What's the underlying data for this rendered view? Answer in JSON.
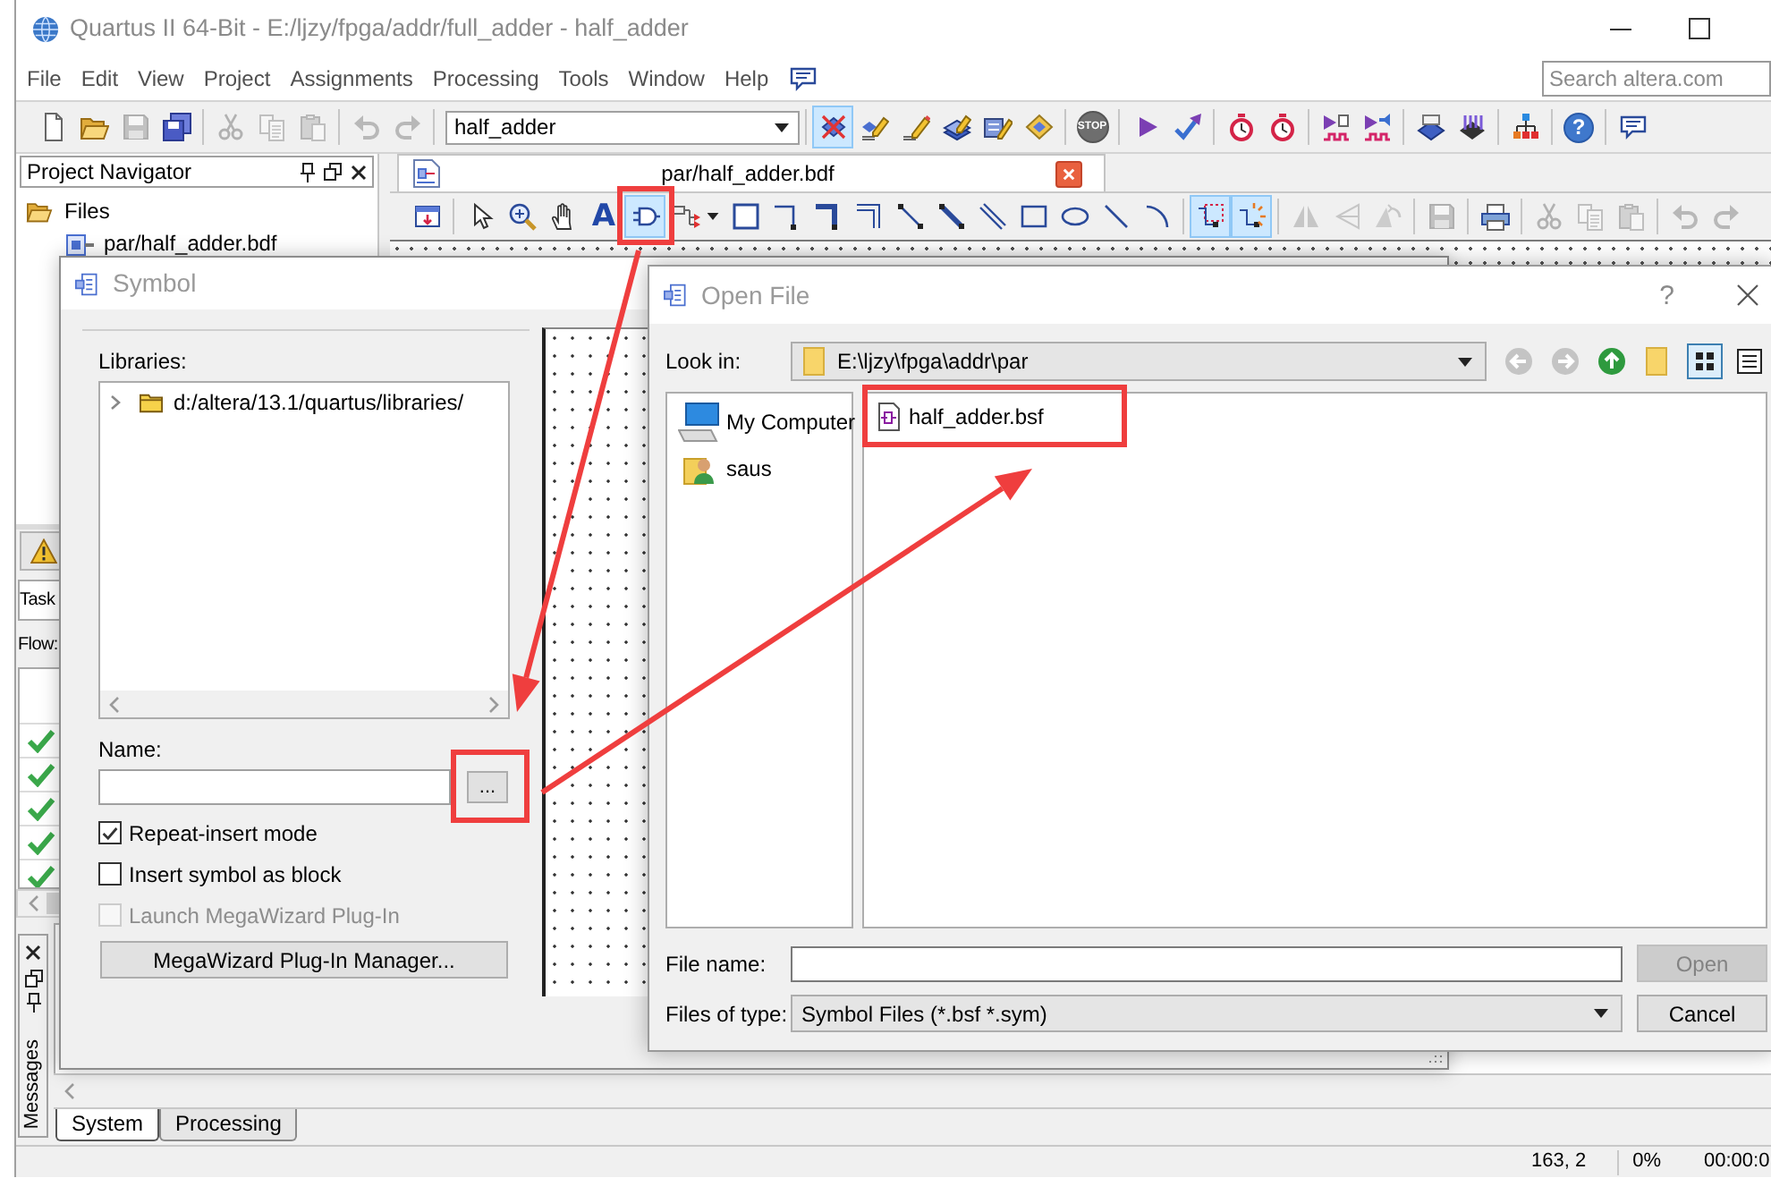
{
  "window": {
    "title": "Quartus II 64-Bit - E:/ljzy/fpga/addr/full_adder - half_adder"
  },
  "menu_bar": [
    "File",
    "Edit",
    "View",
    "Project",
    "Assignments",
    "Processing",
    "Tools",
    "Window",
    "Help"
  ],
  "search": {
    "placeholder": "Search altera.com"
  },
  "toolbar": {
    "entity": "half_adder",
    "buttons": [
      {
        "selected": false,
        "disabled": false
      },
      {
        "selected": false,
        "disabled": false
      },
      {
        "selected": false,
        "disabled": true
      },
      {
        "selected": false,
        "disabled": false
      },
      {
        "selected": false,
        "disabled": true
      },
      {
        "selected": false,
        "disabled": true
      },
      {
        "selected": false,
        "disabled": true
      },
      {
        "selected": false,
        "disabled": true
      },
      {
        "selected": false,
        "disabled": true
      },
      {
        "selected": true,
        "disabled": false
      },
      {
        "selected": false,
        "disabled": false
      },
      {
        "selected": false,
        "disabled": false
      },
      {
        "selected": false,
        "disabled": false
      },
      {
        "selected": false,
        "disabled": false
      },
      {
        "selected": false,
        "disabled": false
      },
      {
        "label": "STOP",
        "selected": false,
        "disabled": true
      },
      {
        "selected": false,
        "disabled": false
      },
      {
        "selected": false,
        "disabled": false
      },
      {
        "selected": false,
        "disabled": false
      },
      {
        "selected": false,
        "disabled": false
      },
      {
        "selected": false,
        "disabled": false
      },
      {
        "selected": false,
        "disabled": false
      },
      {
        "selected": false,
        "disabled": false
      },
      {
        "selected": false,
        "disabled": false
      },
      {
        "selected": false,
        "disabled": false
      },
      {
        "label": "?",
        "selected": false,
        "disabled": false
      },
      {
        "selected": false,
        "disabled": false
      }
    ]
  },
  "project_navigator": {
    "title": "Project Navigator",
    "tree": [
      {
        "label": "Files",
        "expanded": true,
        "children": [
          {
            "label": "par/half_adder.bdf"
          }
        ]
      }
    ]
  },
  "editor": {
    "tab": "par/half_adder.bdf",
    "toolbar": [
      {
        "selected": false,
        "disabled": false
      },
      {
        "selected": false,
        "disabled": false
      },
      {
        "selected": false,
        "disabled": false
      },
      {
        "selected": false,
        "disabled": false
      },
      {
        "label": "A",
        "selected": false,
        "disabled": false
      },
      {
        "selected": true,
        "disabled": false
      },
      {
        "selected": false,
        "disabled": false
      },
      {
        "selected": false,
        "disabled": false
      },
      {
        "selected": false,
        "disabled": false
      },
      {
        "selected": false,
        "disabled": false
      },
      {
        "selected": false,
        "disabled": false
      },
      {
        "selected": false,
        "disabled": false
      },
      {
        "selected": false,
        "disabled": false
      },
      {
        "selected": false,
        "disabled": false
      },
      {
        "selected": false,
        "disabled": false
      },
      {
        "selected": false,
        "disabled": false
      },
      {
        "selected": false,
        "disabled": false
      },
      {
        "selected": false,
        "disabled": false
      },
      {
        "selected": true,
        "disabled": false
      },
      {
        "selected": true,
        "disabled": false
      },
      {
        "selected": false,
        "disabled": true
      },
      {
        "selected": false,
        "disabled": true
      },
      {
        "selected": false,
        "disabled": true
      },
      {
        "selected": false,
        "disabled": true
      },
      {
        "selected": false,
        "disabled": false
      },
      {
        "selected": false,
        "disabled": true
      },
      {
        "selected": false,
        "disabled": true
      },
      {
        "selected": false,
        "disabled": true
      },
      {
        "selected": false,
        "disabled": true
      },
      {
        "selected": false,
        "disabled": true
      }
    ]
  },
  "tasks_panel": {
    "header": "Task",
    "flow_label": "Flow:",
    "rows": [
      {
        "done": true
      },
      {
        "done": true
      },
      {
        "done": true
      },
      {
        "done": true
      },
      {
        "done": true
      }
    ]
  },
  "messages_panel": {
    "title": "Messages",
    "tabs": [
      {
        "label": "System",
        "selected": true
      },
      {
        "label": "Processing",
        "selected": false
      }
    ]
  },
  "status_bar": {
    "position": "163, 2",
    "progress": "0%",
    "time": "00:00:0"
  },
  "symbol_dialog": {
    "title": "Symbol",
    "libraries_label": "Libraries:",
    "libraries": [
      {
        "label": "d:/altera/13.1/quartus/libraries/",
        "expanded": false
      }
    ],
    "name_label": "Name:",
    "browse_button": "...",
    "options": [
      {
        "label": "Repeat-insert mode",
        "checked": true,
        "disabled": false
      },
      {
        "label": "Insert symbol as block",
        "checked": false,
        "disabled": false
      },
      {
        "label": "Launch MegaWizard Plug-In",
        "checked": false,
        "disabled": true
      }
    ],
    "manager_button": "MegaWizard Plug-In Manager..."
  },
  "open_file_dialog": {
    "title": "Open File",
    "help": "?",
    "look_in_label": "Look in:",
    "look_in": "E:\\ljzy\\fpga\\addr\\par",
    "view_buttons": [
      {
        "selected": true
      },
      {
        "selected": false
      }
    ],
    "places": [
      {
        "label": "My Computer",
        "kind": "computer"
      },
      {
        "label": "saus",
        "kind": "user"
      }
    ],
    "files": [
      {
        "name": "half_adder.bsf",
        "selected": false
      }
    ],
    "file_name_label": "File name:",
    "type_label": "Files of type:",
    "file_type": "Symbol Files (*.bsf *.sym)",
    "buttons": [
      {
        "label": "Open",
        "disabled": true
      },
      {
        "label": "Cancel",
        "disabled": false
      }
    ]
  },
  "annotations": [
    {
      "kind": "box"
    },
    {
      "kind": "box"
    },
    {
      "kind": "box"
    },
    {
      "kind": "arrow"
    },
    {
      "kind": "arrow"
    }
  ]
}
